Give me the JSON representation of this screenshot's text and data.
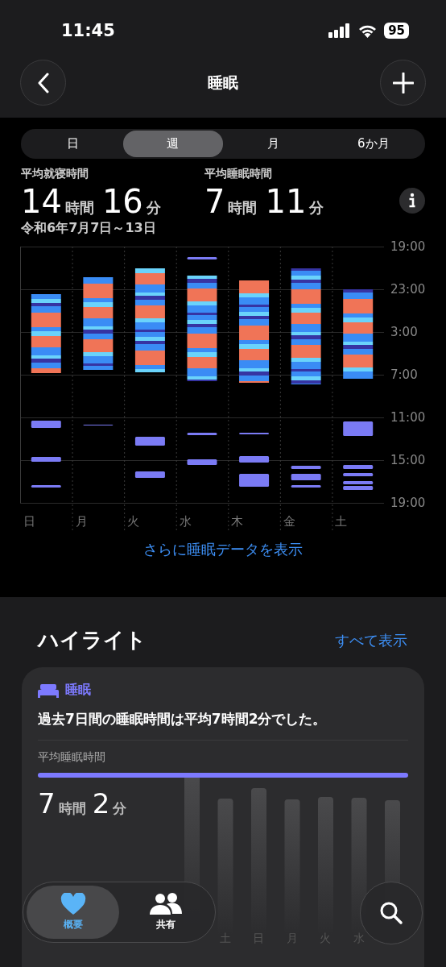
{
  "status_bar": {
    "time": "11:45",
    "battery": "95"
  },
  "nav": {
    "title": "睡眠"
  },
  "segments": [
    {
      "label": "日",
      "selected": false
    },
    {
      "label": "週",
      "selected": true
    },
    {
      "label": "月",
      "selected": false
    },
    {
      "label": "6か月",
      "selected": false
    }
  ],
  "stats": [
    {
      "label": "平均就寝時間",
      "hours": "14",
      "hours_unit": "時間",
      "minutes": "16",
      "minutes_unit": "分"
    },
    {
      "label": "平均睡眠時間",
      "hours": "7",
      "hours_unit": "時間",
      "minutes": "11",
      "minutes_unit": "分"
    }
  ],
  "date_range": "令和6年7月7日～13日",
  "chart": {
    "y_ticks": [
      "19:00",
      "23:00",
      "3:00",
      "7:00",
      "11:00",
      "15:00",
      "19:00"
    ],
    "days": [
      "日",
      "月",
      "火",
      "水",
      "木",
      "金",
      "土"
    ]
  },
  "more_link": "さらに睡眠データを表示",
  "highlights": {
    "title": "ハイライト",
    "see_all": "すべて表示",
    "card": {
      "category": "睡眠",
      "summary": "過去7日間の睡眠時間は平均7時間2分でした。",
      "metric_label": "平均睡眠時間",
      "hours": "7",
      "hours_unit": "時間",
      "minutes": "2",
      "minutes_unit": "分",
      "bar_labels": [
        "土",
        "日",
        "月",
        "火",
        "水"
      ]
    }
  },
  "tab_bar": {
    "tabs": [
      {
        "label": "概要",
        "selected": true,
        "kind": "heart"
      },
      {
        "label": "共有",
        "selected": false,
        "kind": "people"
      }
    ]
  }
}
